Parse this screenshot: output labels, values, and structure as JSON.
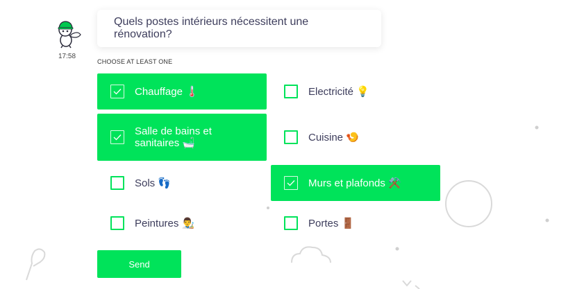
{
  "chat": {
    "time": "17:58",
    "question": "Quels postes intérieurs nécessitent une rénovation?"
  },
  "form": {
    "hint": "CHOOSE AT LEAST ONE",
    "options": [
      {
        "label": "Chauffage 🌡️",
        "selected": true
      },
      {
        "label": "Electricité 💡",
        "selected": false
      },
      {
        "label": "Salle de bains et sanitaires 🛁",
        "selected": true
      },
      {
        "label": "Cuisine 🍤",
        "selected": false
      },
      {
        "label": "Sols 👣",
        "selected": false
      },
      {
        "label": "Murs et plafonds ⚒️",
        "selected": true
      },
      {
        "label": "Peintures 👨‍🎨",
        "selected": false
      },
      {
        "label": "Portes 🚪",
        "selected": false
      }
    ],
    "send_label": "Send"
  },
  "colors": {
    "accent": "#00e35a",
    "text": "#3d3d5c"
  }
}
